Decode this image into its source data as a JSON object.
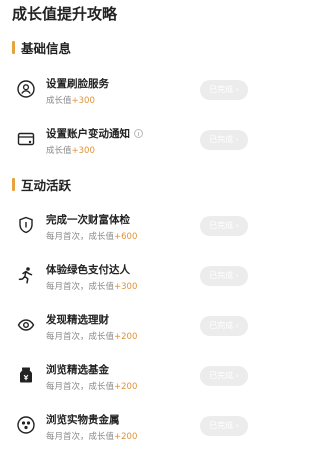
{
  "page": {
    "title": "成长值提升攻略"
  },
  "sections": [
    {
      "title": "基础信息",
      "tasks": [
        {
          "title": "设置刷脸服务",
          "icon": "face-scan-icon",
          "subtitle_prefix": "成长值",
          "reward": "+300",
          "button": "已完成 ›"
        },
        {
          "title": "设置账户变动通知",
          "icon": "account-card-icon",
          "has_info": true,
          "subtitle_prefix": "成长值",
          "reward": "+300",
          "button": "已完成 ›"
        }
      ]
    },
    {
      "title": "互动活跃",
      "tasks": [
        {
          "title": "完成一次财富体检",
          "icon": "shield-check-icon",
          "subtitle_prefix": "每月首次，成长值",
          "reward": "+600",
          "button": "已完成 ›"
        },
        {
          "title": "体验绿色支付达人",
          "icon": "runner-icon",
          "subtitle_prefix": "每月首次，成长值",
          "reward": "+300",
          "button": "已完成 ›"
        },
        {
          "title": "发现精选理财",
          "icon": "eye-icon",
          "subtitle_prefix": "每月首次，成长值",
          "reward": "+200",
          "button": "已完成 ›"
        },
        {
          "title": "浏览精选基金",
          "icon": "fund-jar-icon",
          "subtitle_prefix": "每月首次，成长值",
          "reward": "+200",
          "button": "已完成 ›"
        },
        {
          "title": "浏览实物贵金属",
          "icon": "precious-metal-icon",
          "subtitle_prefix": "每月首次，成长值",
          "reward": "+200",
          "button": "已完成 ›"
        }
      ]
    }
  ]
}
